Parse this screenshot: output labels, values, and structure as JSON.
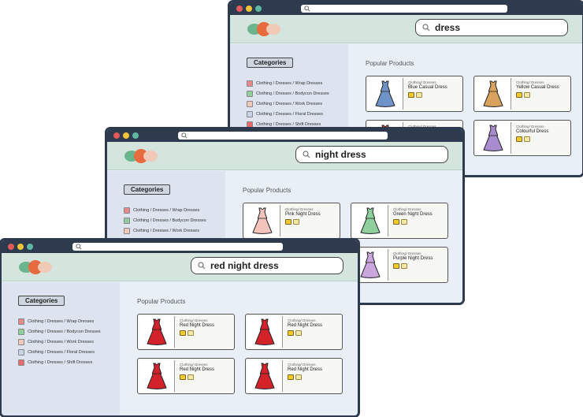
{
  "colors": {
    "frame": "#2e3b4e",
    "header": "#d3e5dd",
    "sidebar": "#dde4ef",
    "content": "#e9eff6"
  },
  "categories_label": "Categories",
  "categories": [
    {
      "label": "Clothing / Dresses / Wrap Dresses",
      "color": "#e88a8a"
    },
    {
      "label": "Clothing / Dresses / Bodycon Dresses",
      "color": "#8fcf9c"
    },
    {
      "label": "Clothing / Dresses / Work Dresses",
      "color": "#f1c9b7"
    },
    {
      "label": "Clothing / Dresses / Floral Dresses",
      "color": "#c9d4e6"
    },
    {
      "label": "Clothing / Dresses / Shift Dresses",
      "color": "#e86a6a"
    }
  ],
  "popular_label": "Popular Products",
  "windows": [
    {
      "query": "dress",
      "products": [
        {
          "path": "Clothing/ Dresses",
          "name": "Blue Casual Dress",
          "color": "#6f93c9",
          "icon": "dress-icon"
        },
        {
          "path": "Clothing/ Dresses",
          "name": "Yellow Casual Dress",
          "color": "#d9a25f",
          "icon": "dress-icon"
        },
        {
          "path": "Clothing/ Dresses",
          "name": "",
          "color": "#d9534f",
          "icon": "dress-icon"
        },
        {
          "path": "Clothing/ Dresses",
          "name": "Colourful Dress",
          "color": "#a88ccf",
          "icon": "dress-icon"
        }
      ]
    },
    {
      "query": "night dress",
      "products": [
        {
          "path": "Clothing/ Dresses",
          "name": "Pink Night Dress",
          "color": "#f2c4bc",
          "icon": "dress-icon"
        },
        {
          "path": "Clothing/ Dresses",
          "name": "Green Night Dress",
          "color": "#8fcf9c",
          "icon": "dress-icon"
        },
        {
          "path": "Clothing/ Dresses",
          "name": "",
          "color": "#d9534f",
          "icon": "dress-icon"
        },
        {
          "path": "Clothing/ Dresses",
          "name": "Purple Night Dress",
          "color": "#c9a6dc",
          "icon": "dress-icon"
        }
      ]
    },
    {
      "query": "red night dress",
      "products": [
        {
          "path": "Clothing/ Dresses",
          "name": "Red Night Dress",
          "color": "#d2232a",
          "icon": "dress-icon"
        },
        {
          "path": "Clothing/ Dresses",
          "name": "Red Night Dress",
          "color": "#d2232a",
          "icon": "dress-icon"
        },
        {
          "path": "Clothing/ Dresses",
          "name": "Red Night Dress",
          "color": "#d2232a",
          "icon": "dress-icon"
        },
        {
          "path": "Clothing/ Dresses",
          "name": "Red Night Dress",
          "color": "#d2232a",
          "icon": "dress-icon"
        }
      ]
    }
  ]
}
